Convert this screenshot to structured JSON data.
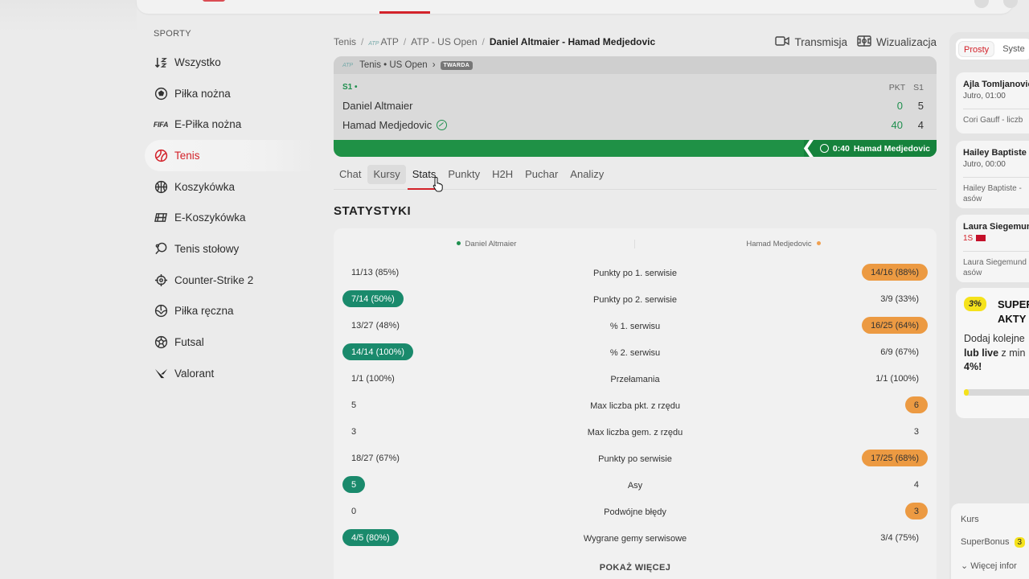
{
  "sidebar": {
    "title": "SPORTY",
    "items": [
      {
        "label": "Wszystko",
        "icon": "sort-icon"
      },
      {
        "label": "Piłka nożna",
        "icon": "football-icon"
      },
      {
        "label": "E-Piłka nożna",
        "icon": "fifa-icon",
        "icon_text": "FIFA"
      },
      {
        "label": "Tenis",
        "icon": "tennis-icon",
        "active": true
      },
      {
        "label": "Koszykówka",
        "icon": "basketball-icon"
      },
      {
        "label": "E-Koszykówka",
        "icon": "e-basketball-icon"
      },
      {
        "label": "Tenis stołowy",
        "icon": "table-tennis-icon"
      },
      {
        "label": "Counter-Strike 2",
        "icon": "crosshair-icon"
      },
      {
        "label": "Piłka ręczna",
        "icon": "handball-icon"
      },
      {
        "label": "Futsal",
        "icon": "futsal-icon"
      },
      {
        "label": "Valorant",
        "icon": "valorant-icon"
      }
    ]
  },
  "breadcrumb": {
    "items": [
      "Tenis",
      "ATP",
      "ATP - US Open"
    ],
    "atp_mark": "ATP",
    "current": "Daniel Altmaier - Hamad Medjedovic"
  },
  "actions": {
    "stream": "Transmisja",
    "visualization": "Wizualizacja"
  },
  "scoreboard": {
    "header": "Tenis • US Open",
    "surface": "TWARDA",
    "set_label": "S1 •",
    "col_points": "PKT",
    "col_set": "S1",
    "players": [
      {
        "name": "Daniel Altmaier",
        "points": "0",
        "set1": "5",
        "serving": false
      },
      {
        "name": "Hamad Medjedovic",
        "points": "40",
        "set1": "4",
        "serving": true
      }
    ],
    "timeline_time": "0:40",
    "timeline_player": "Hamad Medjedovic"
  },
  "tabs": [
    "Chat",
    "Kursy",
    "Stats",
    "Punkty",
    "H2H",
    "Puchar",
    "Analizy"
  ],
  "active_tab": "Stats",
  "stats": {
    "title": "STATYSTYKI",
    "left_player": "Daniel Altmaier",
    "right_player": "Hamad Medjedovic",
    "rows": [
      {
        "label": "Punkty po 1. serwisie",
        "left": "11/13 (85%)",
        "right": "14/16 (88%)",
        "lead": "right"
      },
      {
        "label": "Punkty po 2. serwisie",
        "left": "7/14 (50%)",
        "right": "3/9 (33%)",
        "lead": "left"
      },
      {
        "label": "% 1. serwisu",
        "left": "13/27 (48%)",
        "right": "16/25 (64%)",
        "lead": "right"
      },
      {
        "label": "% 2. serwisu",
        "left": "14/14 (100%)",
        "right": "6/9 (67%)",
        "lead": "left"
      },
      {
        "label": "Przełamania",
        "left": "1/1 (100%)",
        "right": "1/1 (100%)",
        "lead": "none"
      },
      {
        "label": "Max liczba pkt. z rzędu",
        "left": "5",
        "right": "6",
        "lead": "right"
      },
      {
        "label": "Max liczba gem. z rzędu",
        "left": "3",
        "right": "3",
        "lead": "none"
      },
      {
        "label": "Punkty po serwisie",
        "left": "18/27 (67%)",
        "right": "17/25 (68%)",
        "lead": "right"
      },
      {
        "label": "Asy",
        "left": "5",
        "right": "4",
        "lead": "left"
      },
      {
        "label": "Podwójne błędy",
        "left": "0",
        "right": "3",
        "lead": "right"
      },
      {
        "label": "Wygrane gemy serwisowe",
        "left": "4/5 (80%)",
        "right": "3/4 (75%)",
        "lead": "left"
      }
    ],
    "show_more": "POKAŻ WIĘCEJ"
  },
  "betslip": {
    "tabs": [
      "Prosty",
      "Syste"
    ],
    "cards": [
      {
        "name": "Ajla Tomljanovic",
        "time": "Jutro, 01:00",
        "sub": "Cori Gauff - liczb"
      },
      {
        "name": "Hailey Baptiste",
        "time": "Jutro, 00:00",
        "sub": "Hailey Baptiste - asów"
      },
      {
        "name": "Laura Siegemun",
        "time": "1S",
        "sub": "Laura Siegemund asów"
      }
    ],
    "promo": {
      "percent": "3%",
      "headline1": "SUPER",
      "headline2": "AKTY",
      "text1": "Dodaj kolejne",
      "text2_bold": "lub live",
      "text2": " z min",
      "text3": "4%!",
      "progress": 0.06
    },
    "footer": {
      "kurs": "Kurs",
      "superbonus": "SuperBonus",
      "superbonus_badge": "3",
      "more": "Więcej infor"
    }
  },
  "colors": {
    "accent": "#d3222a",
    "green": "#1f9146",
    "teal_pill": "#1a8a6c",
    "orange_pill": "#ec9a42",
    "promo_yellow": "#f5e21b"
  }
}
